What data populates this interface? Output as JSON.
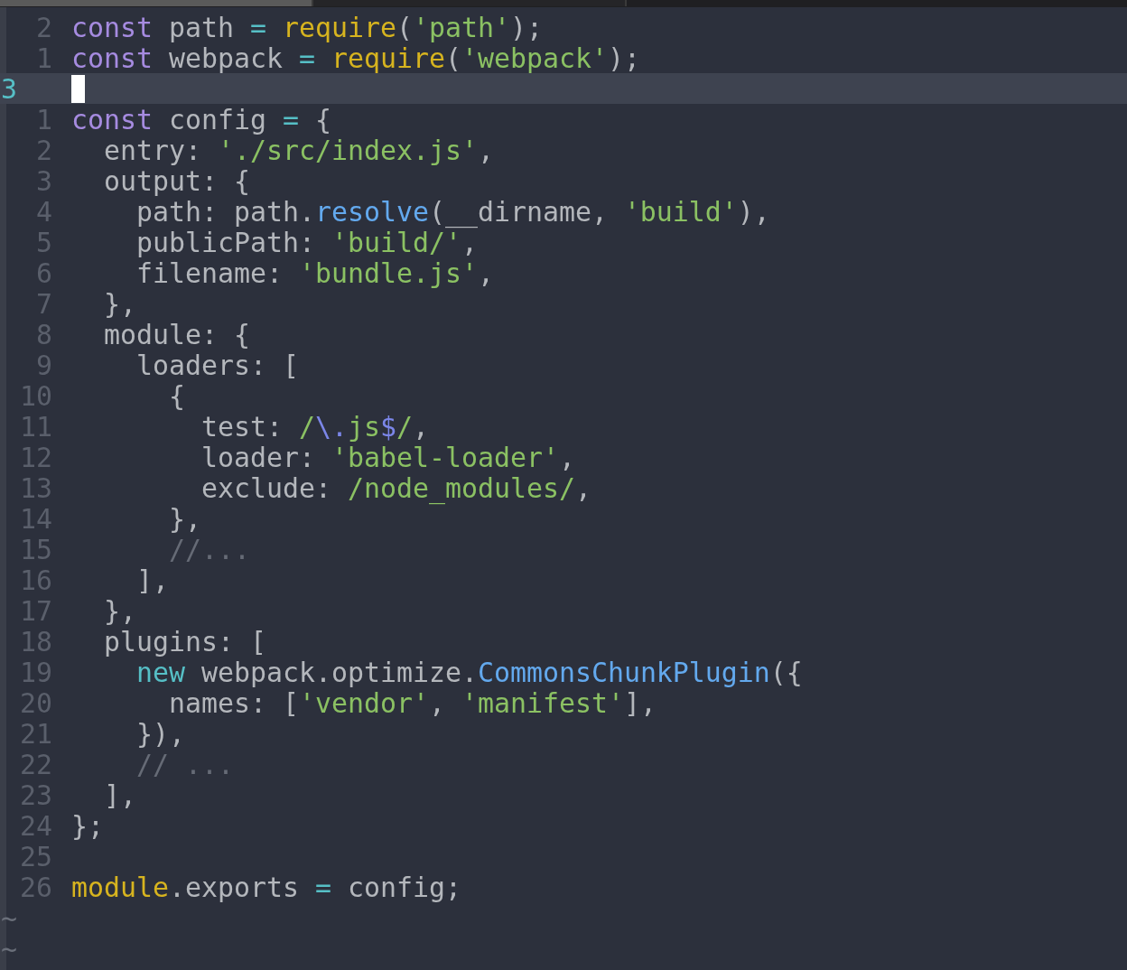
{
  "tabs": [
    {
      "selected": true
    },
    {
      "selected": false
    }
  ],
  "lines": [
    {
      "number": "2",
      "current": false,
      "tokens": [
        {
          "kind": "keyword",
          "text": "const"
        },
        {
          "kind": "plain",
          "text": " path "
        },
        {
          "kind": "operator",
          "text": "="
        },
        {
          "kind": "function",
          "text": " require"
        },
        {
          "kind": "plain",
          "text": "("
        },
        {
          "kind": "string",
          "text": "'path'"
        },
        {
          "kind": "plain",
          "text": ");"
        }
      ]
    },
    {
      "number": "1",
      "current": false,
      "tokens": [
        {
          "kind": "keyword",
          "text": "const"
        },
        {
          "kind": "plain",
          "text": " webpack "
        },
        {
          "kind": "operator",
          "text": "="
        },
        {
          "kind": "function",
          "text": " require"
        },
        {
          "kind": "plain",
          "text": "("
        },
        {
          "kind": "string",
          "text": "'webpack'"
        },
        {
          "kind": "plain",
          "text": ");"
        }
      ]
    },
    {
      "number": "3",
      "current": true,
      "cursor": true
    },
    {
      "number": "1",
      "current": false,
      "tokens": [
        {
          "kind": "keyword",
          "text": "const"
        },
        {
          "kind": "plain",
          "text": " config "
        },
        {
          "kind": "operator",
          "text": "="
        },
        {
          "kind": "plain",
          "text": " {"
        }
      ]
    },
    {
      "number": "2",
      "current": false,
      "tokens": [
        {
          "kind": "plain",
          "text": "  entry: "
        },
        {
          "kind": "string",
          "text": "'./src/index.js'"
        },
        {
          "kind": "plain",
          "text": ","
        }
      ]
    },
    {
      "number": "3",
      "current": false,
      "tokens": [
        {
          "kind": "plain",
          "text": "  output: {"
        }
      ]
    },
    {
      "number": "4",
      "current": false,
      "tokens": [
        {
          "kind": "plain",
          "text": "    path: path."
        },
        {
          "kind": "method",
          "text": "resolve"
        },
        {
          "kind": "plain",
          "text": "(__dirname, "
        },
        {
          "kind": "string",
          "text": "'build'"
        },
        {
          "kind": "plain",
          "text": "),"
        }
      ]
    },
    {
      "number": "5",
      "current": false,
      "tokens": [
        {
          "kind": "plain",
          "text": "    publicPath: "
        },
        {
          "kind": "string",
          "text": "'build/'"
        },
        {
          "kind": "plain",
          "text": ","
        }
      ]
    },
    {
      "number": "6",
      "current": false,
      "tokens": [
        {
          "kind": "plain",
          "text": "    filename: "
        },
        {
          "kind": "string",
          "text": "'bundle.js'"
        },
        {
          "kind": "plain",
          "text": ","
        }
      ]
    },
    {
      "number": "7",
      "current": false,
      "tokens": [
        {
          "kind": "plain",
          "text": "  },"
        }
      ]
    },
    {
      "number": "8",
      "current": false,
      "tokens": [
        {
          "kind": "plain",
          "text": "  module: {"
        }
      ]
    },
    {
      "number": "9",
      "current": false,
      "tokens": [
        {
          "kind": "plain",
          "text": "    loaders: ["
        }
      ]
    },
    {
      "number": "10",
      "current": false,
      "tokens": [
        {
          "kind": "plain",
          "text": "      {"
        }
      ]
    },
    {
      "number": "11",
      "current": false,
      "tokens": [
        {
          "kind": "plain",
          "text": "        test: "
        },
        {
          "kind": "regex",
          "text": "/"
        },
        {
          "kind": "regex_escape",
          "text": "\\."
        },
        {
          "kind": "regex",
          "text": "js"
        },
        {
          "kind": "regex_escape",
          "text": "$"
        },
        {
          "kind": "regex",
          "text": "/"
        },
        {
          "kind": "plain",
          "text": ","
        }
      ]
    },
    {
      "number": "12",
      "current": false,
      "tokens": [
        {
          "kind": "plain",
          "text": "        loader: "
        },
        {
          "kind": "string",
          "text": "'babel-loader'"
        },
        {
          "kind": "plain",
          "text": ","
        }
      ]
    },
    {
      "number": "13",
      "current": false,
      "tokens": [
        {
          "kind": "plain",
          "text": "        exclude: "
        },
        {
          "kind": "regex",
          "text": "/node_modules/"
        },
        {
          "kind": "plain",
          "text": ","
        }
      ]
    },
    {
      "number": "14",
      "current": false,
      "tokens": [
        {
          "kind": "plain",
          "text": "      },"
        }
      ]
    },
    {
      "number": "15",
      "current": false,
      "tokens": [
        {
          "kind": "comment",
          "text": "      //..."
        }
      ]
    },
    {
      "number": "16",
      "current": false,
      "tokens": [
        {
          "kind": "plain",
          "text": "    ],"
        }
      ]
    },
    {
      "number": "17",
      "current": false,
      "tokens": [
        {
          "kind": "plain",
          "text": "  },"
        }
      ]
    },
    {
      "number": "18",
      "current": false,
      "tokens": [
        {
          "kind": "plain",
          "text": "  plugins: ["
        }
      ]
    },
    {
      "number": "19",
      "current": false,
      "tokens": [
        {
          "kind": "new",
          "text": "    new"
        },
        {
          "kind": "plain",
          "text": " webpack.optimize."
        },
        {
          "kind": "method",
          "text": "CommonsChunkPlugin"
        },
        {
          "kind": "plain",
          "text": "({"
        }
      ]
    },
    {
      "number": "20",
      "current": false,
      "tokens": [
        {
          "kind": "plain",
          "text": "      names: ["
        },
        {
          "kind": "string",
          "text": "'vendor'"
        },
        {
          "kind": "plain",
          "text": ", "
        },
        {
          "kind": "string",
          "text": "'manifest'"
        },
        {
          "kind": "plain",
          "text": "],"
        }
      ]
    },
    {
      "number": "21",
      "current": false,
      "tokens": [
        {
          "kind": "plain",
          "text": "    }),"
        }
      ]
    },
    {
      "number": "22",
      "current": false,
      "tokens": [
        {
          "kind": "comment",
          "text": "    // ..."
        }
      ]
    },
    {
      "number": "23",
      "current": false,
      "tokens": [
        {
          "kind": "plain",
          "text": "  ],"
        }
      ]
    },
    {
      "number": "24",
      "current": false,
      "tokens": [
        {
          "kind": "plain",
          "text": "};"
        }
      ]
    },
    {
      "number": "25",
      "current": false
    },
    {
      "number": "26",
      "current": false,
      "tokens": [
        {
          "kind": "function",
          "text": "module"
        },
        {
          "kind": "plain",
          "text": ".exports "
        },
        {
          "kind": "operator",
          "text": "="
        },
        {
          "kind": "plain",
          "text": " config;"
        }
      ]
    }
  ],
  "fillers": [
    "~",
    "~"
  ]
}
